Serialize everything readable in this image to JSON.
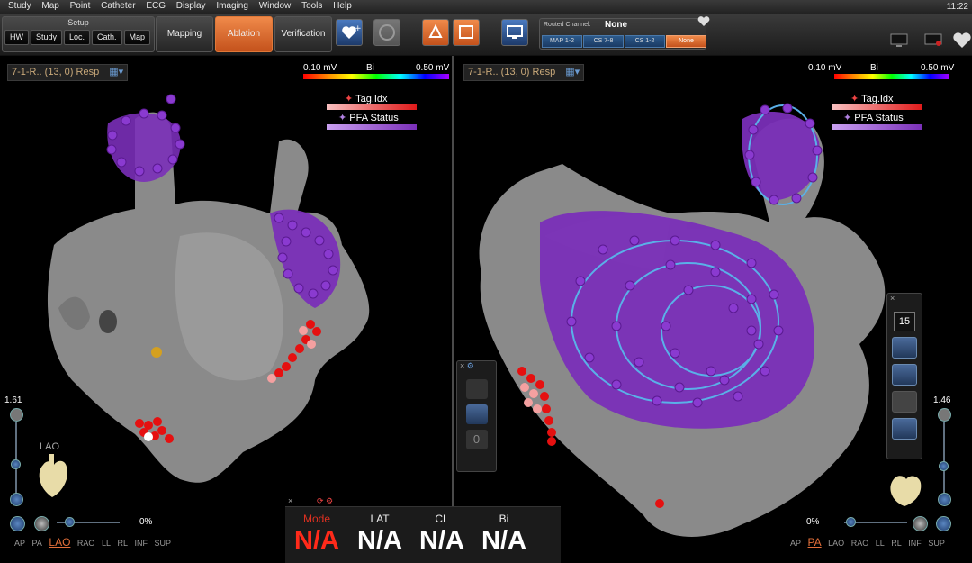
{
  "menu": [
    "Study",
    "Map",
    "Point",
    "Catheter",
    "ECG",
    "Display",
    "Imaging",
    "Window",
    "Tools",
    "Help"
  ],
  "clock": "11:22",
  "setup": {
    "title": "Setup",
    "buttons": [
      "HW",
      "Study",
      "Loc.",
      "Cath.",
      "Map"
    ]
  },
  "modes": {
    "mapping": "Mapping",
    "ablation": "Ablation",
    "verification": "Verification"
  },
  "routed": {
    "label": "Routed Channel:",
    "value": "None",
    "chips": [
      "MAP 1-2",
      "CS 7-8",
      "CS 1-2",
      "None"
    ]
  },
  "left_view": {
    "title": "7-1-R.. (13, 0) Resp",
    "scale_min": "0.10 mV",
    "scale_mode": "Bi",
    "scale_max": "0.50 mV",
    "legend1": "Tag.Idx",
    "legend2": "PFA Status",
    "zoom_value": "1.61",
    "zoom_pct": "0%",
    "orientation": "LAO",
    "orient_opts": [
      "AP",
      "PA",
      "LAO",
      "RAO",
      "LL",
      "RL",
      "INF",
      "SUP"
    ]
  },
  "right_view": {
    "title": "7-1-R.. (13, 0) Resp",
    "scale_min": "0.10 mV",
    "scale_mode": "Bi",
    "scale_max": "0.50 mV",
    "legend1": "Tag.Idx",
    "legend2": "PFA Status",
    "zoom_value": "1.46",
    "zoom_pct": "0%",
    "orient_opts": [
      "AP",
      "PA",
      "LAO",
      "RAO",
      "LL",
      "RL",
      "INF",
      "SUP"
    ],
    "tool_count": "15"
  },
  "status": {
    "mode": {
      "label": "Mode",
      "value": "N/A"
    },
    "lat": {
      "label": "LAT",
      "value": "N/A"
    },
    "cl": {
      "label": "CL",
      "value": "N/A"
    },
    "bi": {
      "label": "Bi",
      "value": "N/A"
    }
  },
  "float_counter": "0",
  "colors": {
    "accent": "#e0652a",
    "pfa": "#7a2fb8",
    "tag": "#e01a1a",
    "chip_blue": "#2c5a8c"
  }
}
